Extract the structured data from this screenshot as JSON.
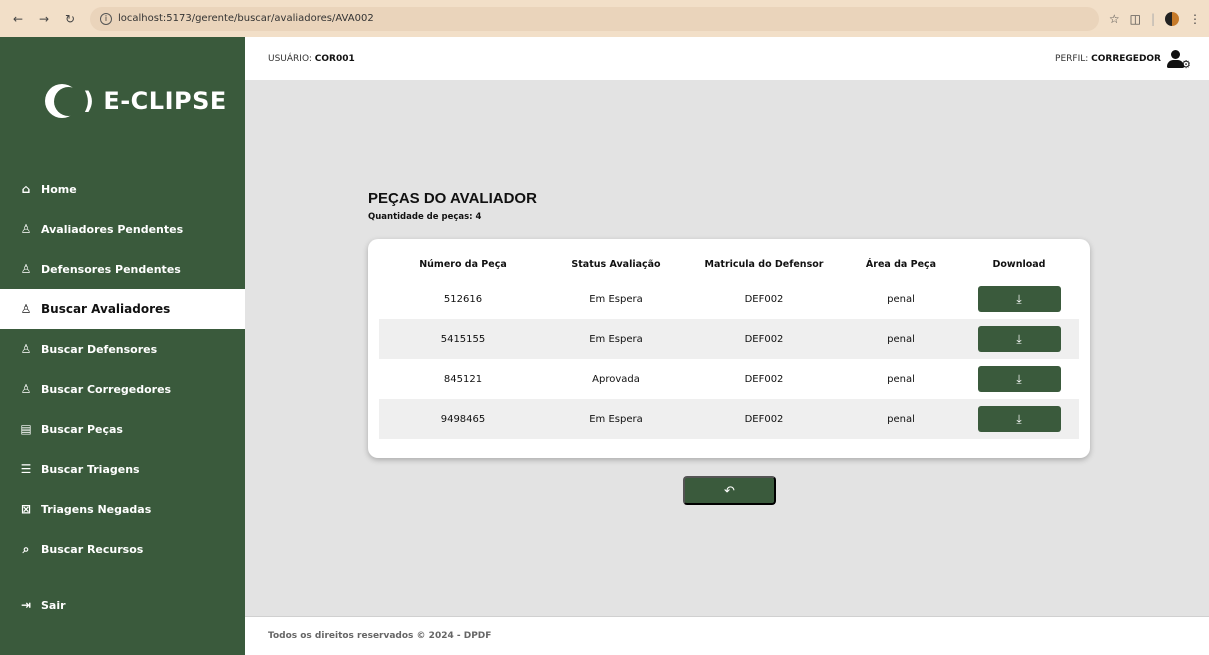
{
  "browser": {
    "url": "localhost:5173/gerente/buscar/avaliadores/AVA002",
    "back_icon": "back-arrow-icon",
    "forward_icon": "forward-arrow-icon",
    "reload_icon": "reload-icon"
  },
  "brand": {
    "name": ") E-CLIPSE"
  },
  "header": {
    "user_label": "USUÁRIO: ",
    "user_value": "COR001",
    "profile_label": "PERFIL: ",
    "profile_value": "CORREGEDOR"
  },
  "sidebar": {
    "items": [
      {
        "label": "Home",
        "icon": "home-icon"
      },
      {
        "label": "Avaliadores Pendentes",
        "icon": "user-pending-icon"
      },
      {
        "label": "Defensores Pendentes",
        "icon": "user-pending-icon"
      },
      {
        "label": "Buscar Avaliadores",
        "icon": "user-search-icon"
      },
      {
        "label": "Buscar Defensores",
        "icon": "user-search-icon"
      },
      {
        "label": "Buscar Corregedores",
        "icon": "user-search-icon"
      },
      {
        "label": "Buscar Peças",
        "icon": "file-search-icon"
      },
      {
        "label": "Buscar Triagens",
        "icon": "list-search-icon"
      },
      {
        "label": "Triagens Negadas",
        "icon": "archive-x-icon"
      },
      {
        "label": "Buscar Recursos",
        "icon": "scan-search-icon"
      }
    ],
    "active_index": 3,
    "logout_label": "Sair"
  },
  "main": {
    "title": "PEÇAS DO AVALIADOR",
    "count_label": "Quantidade de peças: 4",
    "table": {
      "headers": [
        "Número da Peça",
        "Status Avaliação",
        "Matricula do Defensor",
        "Área da Peça",
        "Download"
      ],
      "rows": [
        [
          "512616",
          "Em Espera",
          "DEF002",
          "penal"
        ],
        [
          "5415155",
          "Em Espera",
          "DEF002",
          "penal"
        ],
        [
          "845121",
          "Aprovada",
          "DEF002",
          "penal"
        ],
        [
          "9498465",
          "Em Espera",
          "DEF002",
          "penal"
        ]
      ]
    },
    "back_button_icon": "back-arrow-icon"
  },
  "footer": {
    "text": "Todos os direitos reservados © 2024 - DPDF"
  },
  "colors": {
    "primary": "#3a5a3c",
    "background": "#e3e3e3",
    "browser_bar": "#f2dfc8"
  }
}
